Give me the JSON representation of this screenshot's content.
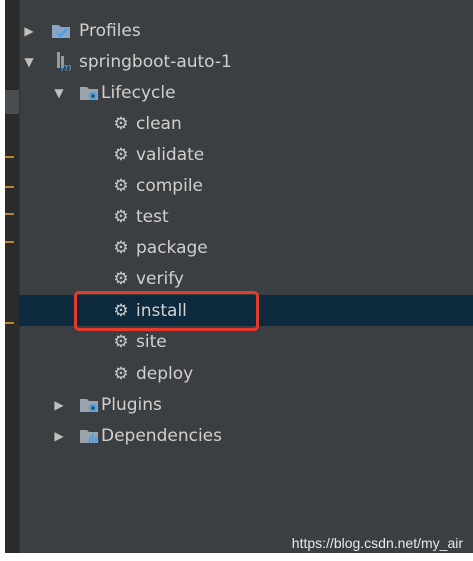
{
  "tree": {
    "profiles": "Profiles",
    "project": "springboot-auto-1",
    "lifecycle": "Lifecycle",
    "goals": [
      "clean",
      "validate",
      "compile",
      "test",
      "package",
      "verify",
      "install",
      "site",
      "deploy"
    ],
    "plugins": "Plugins",
    "dependencies": "Dependencies"
  },
  "selected_goal": "install",
  "watermark": "https://blog.csdn.net/my_air",
  "colors": {
    "panel_bg": "#3c3f41",
    "selection_bg": "#0d293e",
    "highlight_border": "#e23b2e",
    "text": "#d0d0d0"
  }
}
